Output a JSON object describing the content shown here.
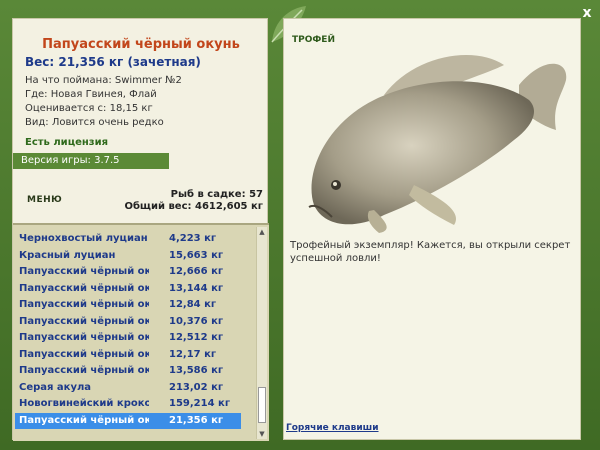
{
  "window": {
    "close_label": "x"
  },
  "fish": {
    "name": "Папуасский чёрный окунь",
    "weight": "Вес: 21,356 кг (зачетная)",
    "lure": "На что поймана: Swimmer №2",
    "place": "Где: Новая Гвинея, Флай",
    "value": "Оценивается с: 18,15 кг",
    "rarity": "Вид: Ловится очень редко"
  },
  "license": "Есть лицензия",
  "version": "Версия игры: 3.7.5",
  "menu_label": "МЕНЮ",
  "stats": {
    "count": "Рыб в садке: 57",
    "total": "Общий вес: 4612,605 кг"
  },
  "catch_list": [
    {
      "name": "Чернохвостый луциан",
      "weight": "4,223 кг"
    },
    {
      "name": "Красный луциан",
      "weight": "15,663 кг"
    },
    {
      "name": "Папуасский чёрный ок...",
      "weight": "12,666 кг"
    },
    {
      "name": "Папуасский чёрный ок...",
      "weight": "13,144 кг"
    },
    {
      "name": "Папуасский чёрный ок...",
      "weight": "12,84 кг"
    },
    {
      "name": "Папуасский чёрный ок...",
      "weight": "10,376 кг"
    },
    {
      "name": "Папуасский чёрный ок...",
      "weight": "12,512 кг"
    },
    {
      "name": "Папуасский чёрный ок...",
      "weight": "12,17 кг"
    },
    {
      "name": "Папуасский чёрный ок...",
      "weight": "13,586 кг"
    },
    {
      "name": "Серая акула",
      "weight": "213,02 кг"
    },
    {
      "name": "Новогвинейский крокo...",
      "weight": "159,214 кг"
    },
    {
      "name": "Папуасский чёрный ок...",
      "weight": "21,356 кг"
    }
  ],
  "selected_index": 11,
  "trophy": {
    "label": "ТРОФЕЙ",
    "text": "Трофейный экземпляр! Кажется, вы открыли секрет успешной ловли!"
  },
  "hotkeys_label": "Горячие клавиши",
  "colors": {
    "frame": "#4e7a2f",
    "panel": "#f3f1e2",
    "selection": "#3b8ee8",
    "title": "#c2461b",
    "link": "#1e3a8a"
  }
}
